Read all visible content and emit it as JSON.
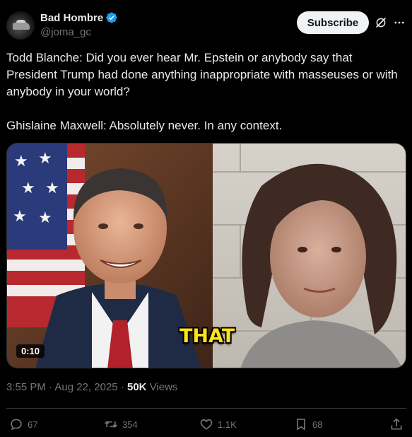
{
  "author": {
    "display_name": "Bad Hombre",
    "handle": "@joma_gc",
    "verified": true,
    "avatar_icon": "car-avatar"
  },
  "header": {
    "subscribe_label": "Subscribe",
    "grok_icon": "grok-icon",
    "more_icon": "more-icon"
  },
  "tweet": {
    "text": "Todd Blanche: Did you ever hear Mr. Epstein or anybody say that President Trump had done anything inappropriate with masseuses or with anybody in your world?\n\nGhislaine Maxwell: Absolutely never. In any context."
  },
  "media": {
    "type": "video",
    "duration": "0:10",
    "caption_word": "THAT",
    "caption_color": "#ffe21a"
  },
  "meta": {
    "time": "3:55 PM",
    "separator": "·",
    "date": "Aug 22, 2025",
    "views_count": "50K",
    "views_label": "Views"
  },
  "actions": {
    "replies": "67",
    "reposts": "354",
    "likes": "1.1K",
    "bookmarks": "68"
  },
  "colors": {
    "background": "#000000",
    "text_primary": "#e7e9ea",
    "text_secondary": "#71767b",
    "verified_blue": "#1d9bf0",
    "divider": "#2f3336"
  }
}
